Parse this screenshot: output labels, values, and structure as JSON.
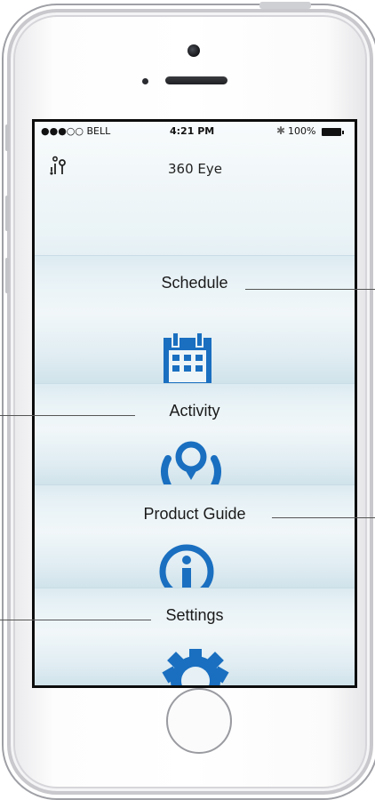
{
  "status_bar": {
    "carrier": "●●●○○ BELL",
    "time": "4:21 PM",
    "bluetooth": "✱",
    "battery_percent": "100%"
  },
  "app": {
    "title": "360 Eye",
    "logo_icon": "robot-logo-icon"
  },
  "menu": [
    {
      "label": "Schedule",
      "icon": "calendar-icon"
    },
    {
      "label": "Activity",
      "icon": "location-pin-icon"
    },
    {
      "label": "Product Guide",
      "icon": "info-icon"
    },
    {
      "label": "Settings",
      "icon": "gear-icon"
    }
  ],
  "colors": {
    "accent": "#1a6fc0",
    "section_light": "#f1f7f9",
    "section_dark": "#cfe2ea"
  }
}
